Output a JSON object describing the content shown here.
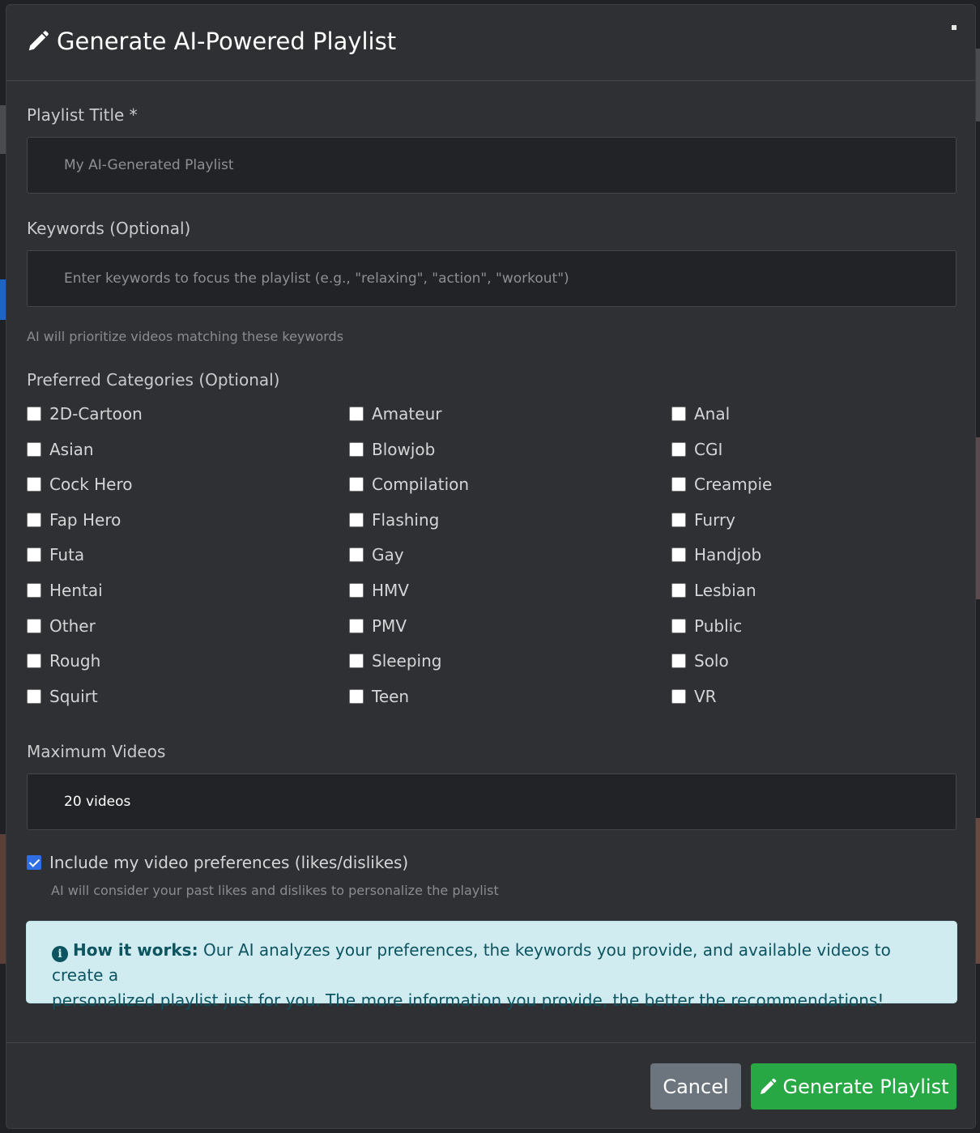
{
  "modal": {
    "title": "Generate AI-Powered Playlist",
    "title_icon": "pencil-icon",
    "close_icon": "close-icon"
  },
  "form": {
    "title_label": "Playlist Title *",
    "title_placeholder": "My AI-Generated Playlist",
    "keywords_label": "Keywords (Optional)",
    "keywords_placeholder": "Enter keywords to focus the playlist (e.g., \"relaxing\", \"action\", \"workout\")",
    "keywords_help": "AI will prioritize videos matching these keywords",
    "categories_label": "Preferred Categories (Optional)",
    "categories": [
      "2D-Cartoon",
      "Amateur",
      "Anal",
      "Asian",
      "Blowjob",
      "CGI",
      "Cock Hero",
      "Compilation",
      "Creampie",
      "Fap Hero",
      "Flashing",
      "Furry",
      "Futa",
      "Gay",
      "Handjob",
      "Hentai",
      "HMV",
      "Lesbian",
      "Other",
      "PMV",
      "Public",
      "Rough",
      "Sleeping",
      "Solo",
      "Squirt",
      "Teen",
      "VR"
    ],
    "max_label": "Maximum Videos",
    "max_value": "20 videos",
    "prefs_label": "Include my video preferences (likes/dislikes)",
    "prefs_checked": true,
    "prefs_help": "AI will consider your past likes and dislikes to personalize the playlist"
  },
  "info": {
    "icon": "info-icon",
    "heading": "How it works:",
    "line1": " Our AI analyzes your preferences, the keywords you provide, and available videos to create a",
    "line2": "personalized playlist just for you. The more information you provide, the better the recommendations!"
  },
  "footer": {
    "cancel_label": "Cancel",
    "generate_label": "Generate Playlist",
    "generate_icon": "pencil-icon"
  },
  "colors": {
    "modal_bg": "#2f3033",
    "input_bg": "#222326",
    "info_bg": "#d1ecf1",
    "info_text": "#0c5460",
    "cancel_bg": "#6c757d",
    "generate_bg": "#28a745",
    "checkbox_checked": "#2f6fe4"
  }
}
